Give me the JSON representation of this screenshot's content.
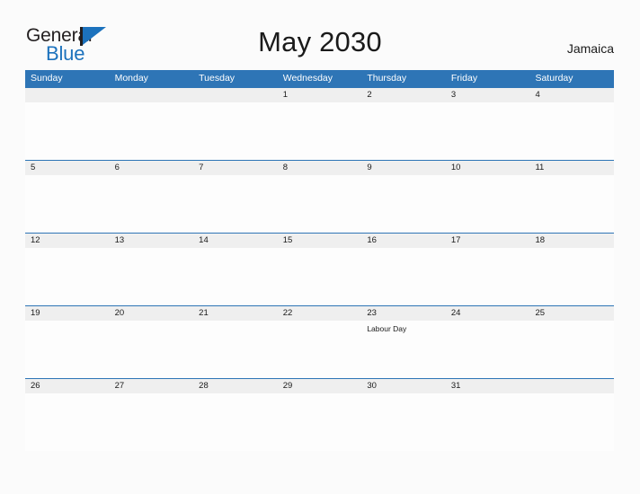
{
  "logo": {
    "text_primary": "General",
    "text_secondary": "Blue",
    "icon": "flag-triangle-icon",
    "primary_color": "#231f20",
    "accent_color": "#1c72bd"
  },
  "header": {
    "title": "May 2030",
    "country": "Jamaica"
  },
  "colors": {
    "header_blue": "#2e75b6",
    "date_band_gray": "#efefef",
    "page_background": "#fbfbfb",
    "text": "#1a1a1a"
  },
  "calendar": {
    "weekdays": [
      "Sunday",
      "Monday",
      "Tuesday",
      "Wednesday",
      "Thursday",
      "Friday",
      "Saturday"
    ],
    "weeks": [
      [
        {
          "date": "",
          "event": ""
        },
        {
          "date": "",
          "event": ""
        },
        {
          "date": "",
          "event": ""
        },
        {
          "date": "1",
          "event": ""
        },
        {
          "date": "2",
          "event": ""
        },
        {
          "date": "3",
          "event": ""
        },
        {
          "date": "4",
          "event": ""
        }
      ],
      [
        {
          "date": "5",
          "event": ""
        },
        {
          "date": "6",
          "event": ""
        },
        {
          "date": "7",
          "event": ""
        },
        {
          "date": "8",
          "event": ""
        },
        {
          "date": "9",
          "event": ""
        },
        {
          "date": "10",
          "event": ""
        },
        {
          "date": "11",
          "event": ""
        }
      ],
      [
        {
          "date": "12",
          "event": ""
        },
        {
          "date": "13",
          "event": ""
        },
        {
          "date": "14",
          "event": ""
        },
        {
          "date": "15",
          "event": ""
        },
        {
          "date": "16",
          "event": ""
        },
        {
          "date": "17",
          "event": ""
        },
        {
          "date": "18",
          "event": ""
        }
      ],
      [
        {
          "date": "19",
          "event": ""
        },
        {
          "date": "20",
          "event": ""
        },
        {
          "date": "21",
          "event": ""
        },
        {
          "date": "22",
          "event": ""
        },
        {
          "date": "23",
          "event": "Labour Day"
        },
        {
          "date": "24",
          "event": ""
        },
        {
          "date": "25",
          "event": ""
        }
      ],
      [
        {
          "date": "26",
          "event": ""
        },
        {
          "date": "27",
          "event": ""
        },
        {
          "date": "28",
          "event": ""
        },
        {
          "date": "29",
          "event": ""
        },
        {
          "date": "30",
          "event": ""
        },
        {
          "date": "31",
          "event": ""
        },
        {
          "date": "",
          "event": ""
        }
      ]
    ]
  }
}
